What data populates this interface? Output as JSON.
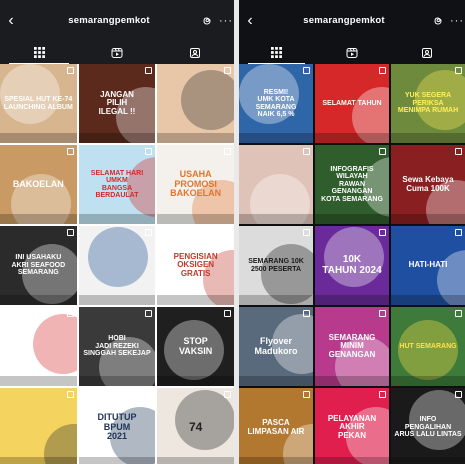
{
  "left": {
    "topbar": {
      "back": "‹",
      "username": "semarangpemkot",
      "more": "···"
    },
    "posts": [
      {
        "caption": "SPESIAL HUT KE-74\nLAUNCHING ALBUM",
        "bg": "#d7b58f",
        "fg": "#ffffff",
        "size": 7
      },
      {
        "caption": "JANGAN\nPILIH\nILEGAL !!",
        "bg": "#5c2a1c",
        "fg": "#ffffff",
        "size": 8
      },
      {
        "caption": "",
        "bg": "#e8c6a8",
        "fg": "#333333",
        "size": 7
      },
      {
        "caption": "BAKOELAN",
        "bg": "#c99a63",
        "fg": "#ffffff",
        "size": 9
      },
      {
        "caption": "SELAMAT HARI\nUMKM\nBANGSA BERDAULAT",
        "bg": "#bfe0f0",
        "fg": "#d62828",
        "size": 7
      },
      {
        "caption": "USAHA\nPROMOSI\nBAKOELAN",
        "bg": "#f4f1ec",
        "fg": "#e2742b",
        "size": 9
      },
      {
        "caption": "INI USAHAKU\nAKRI SEAFOOD\nSEMARANG",
        "bg": "#2b2b2b",
        "fg": "#ffffff",
        "size": 7
      },
      {
        "caption": "",
        "bg": "#f2f2f2",
        "fg": "#1d4f91",
        "size": 6
      },
      {
        "caption": "PENGISIAN\nOKSIGEN\nGRATIS",
        "bg": "#ffffff",
        "fg": "#c0392b",
        "size": 8
      },
      {
        "caption": "",
        "bg": "#ffffff",
        "fg": "#d62828",
        "size": 6
      },
      {
        "caption": "HOBI\nJADI REZEKI\nSINGGAH SEKEJAP",
        "bg": "#3a3a3a",
        "fg": "#ffffff",
        "size": 7
      },
      {
        "caption": "STOP\nVAKSIN",
        "bg": "#1f1f1f",
        "fg": "#ffffff",
        "size": 9
      },
      {
        "caption": "",
        "bg": "#f4d35e",
        "fg": "#333333",
        "size": 6
      },
      {
        "caption": "DITUTUP\nBPUM\n2021",
        "bg": "#ffffff",
        "fg": "#1d3557",
        "size": 9
      },
      {
        "caption": "74",
        "bg": "#ede7df",
        "fg": "#222222",
        "size": 12
      }
    ]
  },
  "right": {
    "topbar": {
      "back": "‹",
      "username": "semarangpemkot",
      "more": "···"
    },
    "posts": [
      {
        "caption": "RESMI!\nUMK KOTA SEMARANG\nNAIK 6,5 %",
        "bg": "#2f66a8",
        "fg": "#ffffff",
        "size": 7
      },
      {
        "caption": "SELAMAT TAHUN",
        "bg": "#d62828",
        "fg": "#ffffff",
        "size": 7
      },
      {
        "caption": "YUK SEGERA\nPERIKSA\nMENIMPA RUMAH",
        "bg": "#6e8b3d",
        "fg": "#ffef5a",
        "size": 7
      },
      {
        "caption": "",
        "bg": "#e0c3b8",
        "fg": "#ffffff",
        "size": 6
      },
      {
        "caption": "INFOGRAFIS\nWILAYAH\nRAWAN\nGENANGAN\nKOTA SEMARANG",
        "bg": "#2f5d2c",
        "fg": "#ffffff",
        "size": 7
      },
      {
        "caption": "Sewa Kebaya\nCuma 100K",
        "bg": "#8a1f22",
        "fg": "#ffffff",
        "size": 8
      },
      {
        "caption": "SEMARANG 10K\n2500 PESERTA",
        "bg": "#dcdcdc",
        "fg": "#1a1a1a",
        "size": 7
      },
      {
        "caption": "10K\nTAHUN 2024",
        "bg": "#6a2a9a",
        "fg": "#ffffff",
        "size": 10
      },
      {
        "caption": "HATI-HATI",
        "bg": "#1f4fa0",
        "fg": "#ffffff",
        "size": 8
      },
      {
        "caption": "Flyover\nMadukoro",
        "bg": "#596a7d",
        "fg": "#ffffff",
        "size": 9
      },
      {
        "caption": "SEMARANG\nMINIM\nGENANGAN",
        "bg": "#b83a8c",
        "fg": "#ffffff",
        "size": 8
      },
      {
        "caption": "HUT SEMARANG",
        "bg": "#3e7b3a",
        "fg": "#ffe14a",
        "size": 7
      },
      {
        "caption": "PASCA\nLIMPASAN AIR",
        "bg": "#b3782f",
        "fg": "#ffffff",
        "size": 8
      },
      {
        "caption": "PELAYANAN\nAKHIR\nPEKAN",
        "bg": "#e01f4f",
        "fg": "#ffffff",
        "size": 8
      },
      {
        "caption": "INFO\nPENGALIHAN\nARUS LALU LINTAS",
        "bg": "#1a1a1a",
        "fg": "#ffffff",
        "size": 7
      }
    ]
  }
}
